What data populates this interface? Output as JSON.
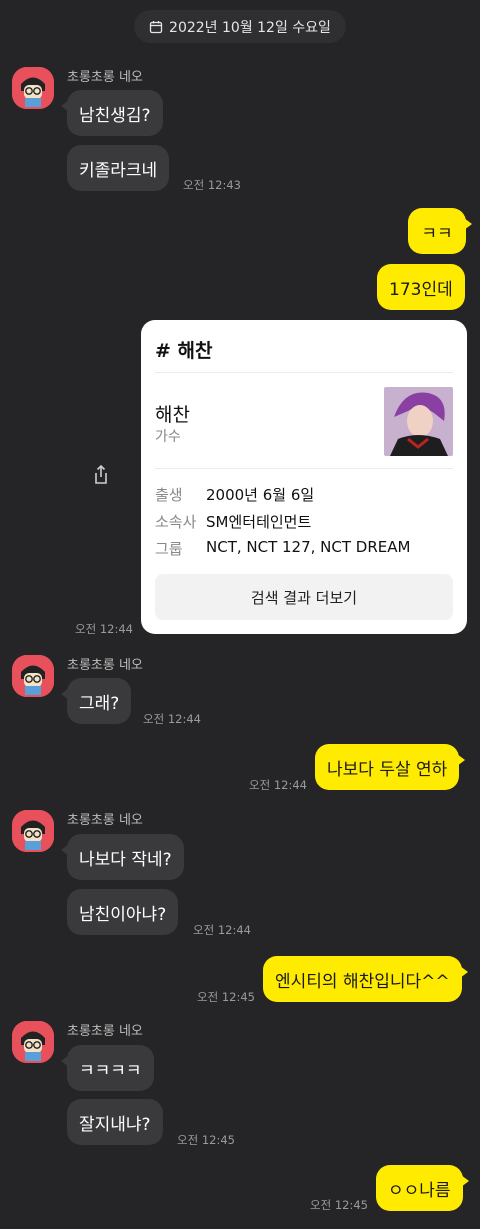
{
  "date_divider": {
    "label": "2022년 10월 12일 수요일",
    "icon": "calendar-icon"
  },
  "sender_name": "초롱초롱 네오",
  "messages": {
    "m1": "남친생김?",
    "m2": "키졸라크네",
    "t2": "오전 12:43",
    "m3": "ㅋㅋ",
    "m4": "173인데",
    "m6": "그래?",
    "t6": "오전 12:44",
    "m7": "나보다 두살 연하",
    "t7": "오전 12:44",
    "m8": "나보다 작네?",
    "m9": "남친이아냐?",
    "t9": "오전 12:44",
    "m10": "엔시티의 해찬입니다^^",
    "t10": "오전 12:45",
    "m11": "ㅋㅋㅋㅋ",
    "m12": "잘지내냐?",
    "t12": "오전 12:45",
    "m13": "ㅇㅇ나름",
    "t13": "오전 12:45"
  },
  "search_card": {
    "title": "# 해찬",
    "name": "해찬",
    "role": "가수",
    "rows": [
      {
        "label": "출생",
        "value": "2000년 6월 6일"
      },
      {
        "label": "소속사",
        "value": "SM엔터테인먼트"
      },
      {
        "label": "그룹",
        "value": "NCT, NCT 127, NCT DREAM"
      }
    ],
    "more_label": "검색 결과 더보기",
    "time": "오전 12:44"
  },
  "colors": {
    "background": "#252527",
    "incoming_bubble": "#3a3a3c",
    "outgoing_bubble": "#ffeb00",
    "avatar": "#e8505b"
  }
}
